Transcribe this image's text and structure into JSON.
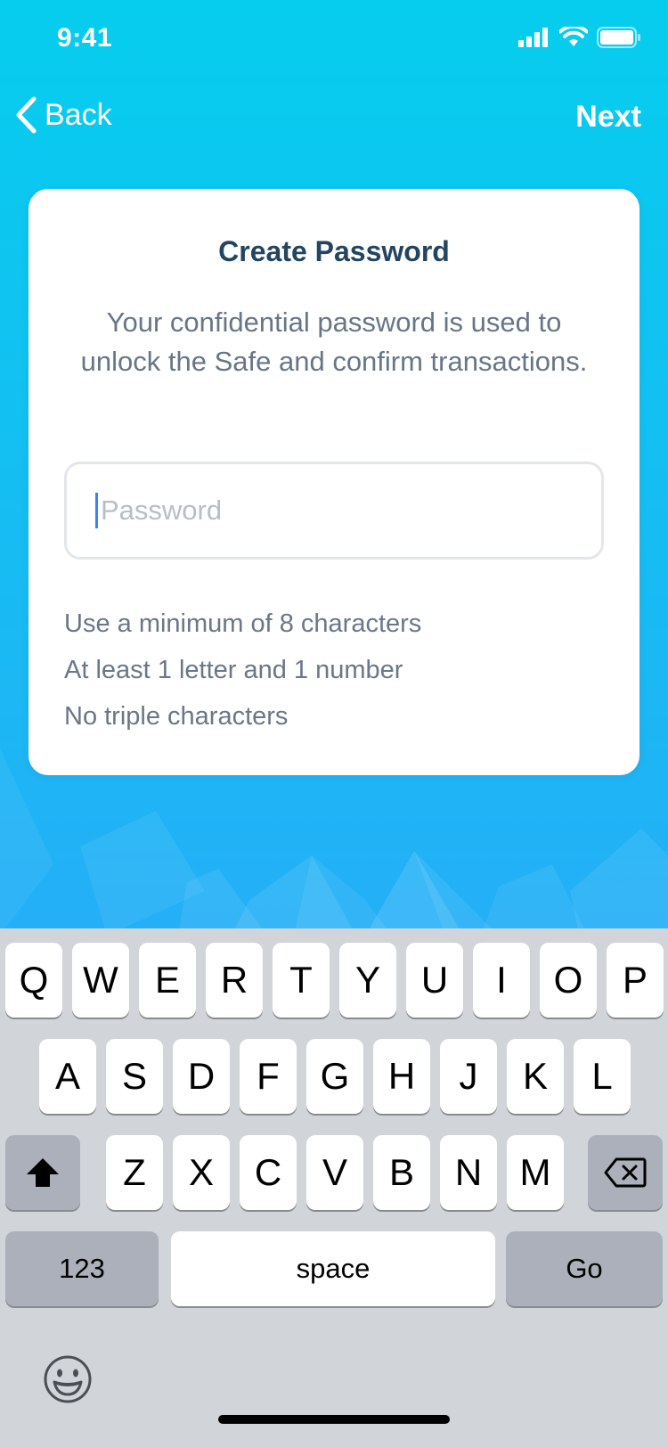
{
  "status_bar": {
    "time": "9:41"
  },
  "nav": {
    "back_label": "Back",
    "next_label": "Next"
  },
  "card": {
    "title": "Create Password",
    "description": "Your confidential password is used to unlock the Safe and confirm transactions.",
    "password_placeholder": "Password",
    "rules": [
      "Use a minimum of 8 characters",
      "At least 1 letter and 1 number",
      "No triple characters"
    ]
  },
  "keyboard": {
    "row1": [
      "Q",
      "W",
      "E",
      "R",
      "T",
      "Y",
      "U",
      "I",
      "O",
      "P"
    ],
    "row2": [
      "A",
      "S",
      "D",
      "F",
      "G",
      "H",
      "J",
      "K",
      "L"
    ],
    "row3": [
      "Z",
      "X",
      "C",
      "V",
      "B",
      "N",
      "M"
    ],
    "numbers_label": "123",
    "space_label": "space",
    "go_label": "Go"
  },
  "colors": {
    "title": "#23455f",
    "caret": "#3b82f6",
    "keyboard_bg": "#d1d4d9"
  }
}
